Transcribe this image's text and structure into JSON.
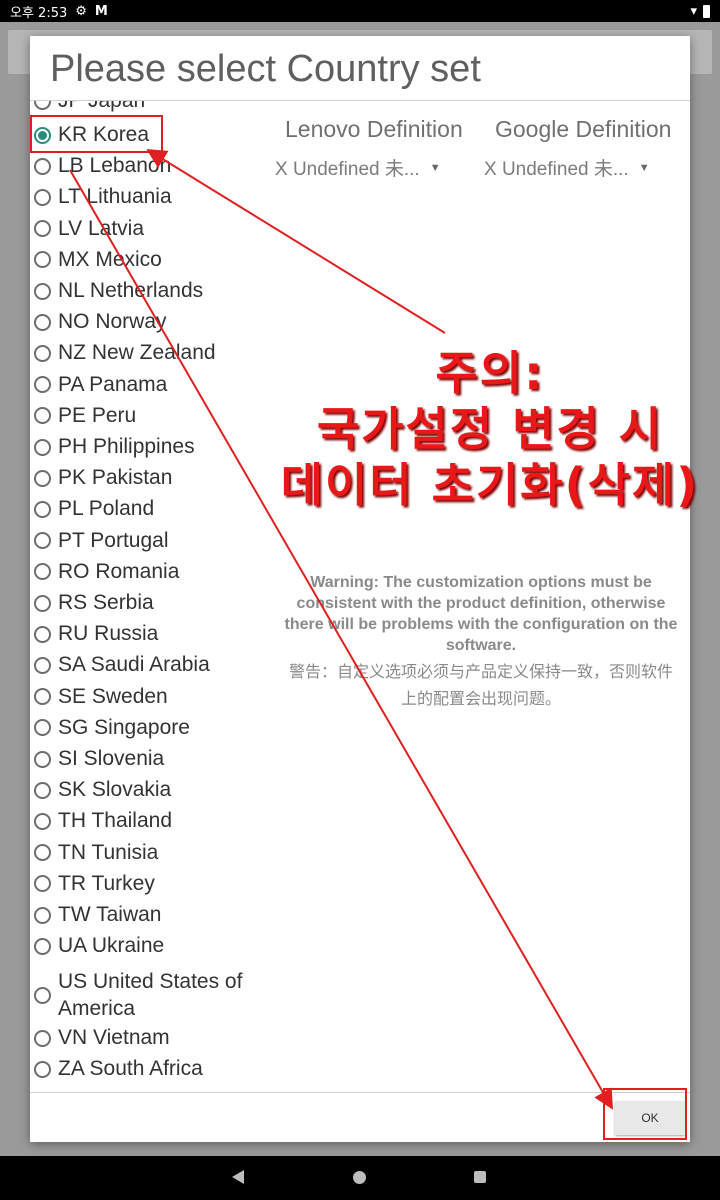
{
  "status": {
    "time": "오후 2:53"
  },
  "dialog": {
    "title": "Please select Country set",
    "partial_top_item": "JP Japan",
    "countries": [
      {
        "label": "KR Korea",
        "checked": true
      },
      {
        "label": "LB Lebanon",
        "checked": false
      },
      {
        "label": "LT Lithuania",
        "checked": false
      },
      {
        "label": "LV Latvia",
        "checked": false
      },
      {
        "label": "MX Mexico",
        "checked": false
      },
      {
        "label": "NL Netherlands",
        "checked": false
      },
      {
        "label": "NO Norway",
        "checked": false
      },
      {
        "label": "NZ New Zealand",
        "checked": false
      },
      {
        "label": "PA Panama",
        "checked": false
      },
      {
        "label": "PE Peru",
        "checked": false
      },
      {
        "label": "PH Philippines",
        "checked": false
      },
      {
        "label": "PK Pakistan",
        "checked": false
      },
      {
        "label": "PL Poland",
        "checked": false
      },
      {
        "label": "PT Portugal",
        "checked": false
      },
      {
        "label": "RO Romania",
        "checked": false
      },
      {
        "label": "RS Serbia",
        "checked": false
      },
      {
        "label": "RU Russia",
        "checked": false
      },
      {
        "label": "SA Saudi Arabia",
        "checked": false
      },
      {
        "label": "SE Sweden",
        "checked": false
      },
      {
        "label": "SG Singapore",
        "checked": false
      },
      {
        "label": "SI Slovenia",
        "checked": false
      },
      {
        "label": "SK Slovakia",
        "checked": false
      },
      {
        "label": "TH Thailand",
        "checked": false
      },
      {
        "label": "TN Tunisia",
        "checked": false
      },
      {
        "label": "TR Turkey",
        "checked": false
      },
      {
        "label": "TW Taiwan",
        "checked": false
      },
      {
        "label": "UA Ukraine",
        "checked": false
      },
      {
        "label": "US United States of America",
        "checked": false,
        "line1": "US United States of",
        "line2": "America"
      },
      {
        "label": "VN Vietnam",
        "checked": false
      },
      {
        "label": "ZA South Africa",
        "checked": false
      }
    ],
    "lenovo_header": "Lenovo Definition",
    "google_header": "Google Definition",
    "lenovo_value": "X Undefined 未...",
    "google_value": "X Undefined 未...",
    "warning_en": "Warning: The customization options must be consistent with the product definition, otherwise there will be problems with the configuration on the software.",
    "warning_cn": "警告：自定义选项必须与产品定义保持一致，否则软件上的配置会出现问题。",
    "ok_label": "OK"
  },
  "annotation": {
    "line1": "주의:",
    "line2": "국가설정 변경 시",
    "line3": "데이터 초기화(삭제)",
    "color": "#e81818"
  },
  "icons": [
    "gear-icon",
    "gmail-icon",
    "wifi-icon",
    "battery-icon",
    "back-icon",
    "home-icon",
    "recents-icon"
  ]
}
